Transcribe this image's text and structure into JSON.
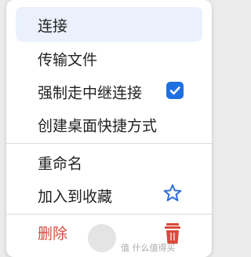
{
  "menu": {
    "items": [
      {
        "label": "连接"
      },
      {
        "label": "传输文件"
      },
      {
        "label": "强制走中继连接"
      },
      {
        "label": "创建桌面快捷方式"
      },
      {
        "label": "重命名"
      },
      {
        "label": "加入到收藏"
      },
      {
        "label": "删除"
      }
    ],
    "force_relay_checked": true
  },
  "watermark": {
    "text": "值 什么值得买"
  },
  "colors": {
    "accent": "#1f6fe0",
    "danger": "#d84a3a",
    "hover": "#eaf1fd"
  },
  "icons": {
    "check": "checkbox-checked-icon",
    "star": "star-outline-icon",
    "trash": "trash-icon"
  }
}
